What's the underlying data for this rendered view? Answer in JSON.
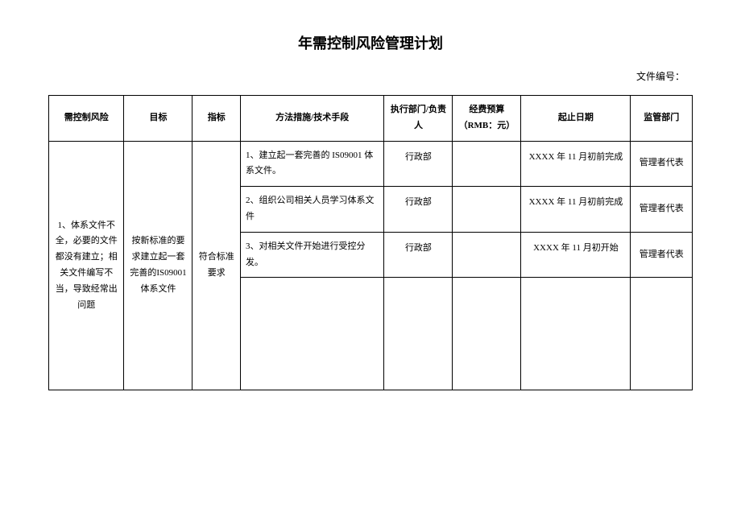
{
  "title": "年需控制风险管理计划",
  "doc_number_label": "文件编号：",
  "headers": {
    "risk": "需控制风险",
    "target": "目标",
    "index": "指标",
    "method": "方法措施/技术手段",
    "dept": "执行部门/负责人",
    "budget": "经费预算",
    "budget_unit": "（RMB：元）",
    "date": "起止日期",
    "supervisor": "监管部门"
  },
  "rows": {
    "risk": "1、体系文件不全，必要的文件都没有建立；相关文件编写不当，导致经常出问题",
    "target": "按新标准的要求建立起一套完善的IS09001 体系文件",
    "index": "符合标准要求",
    "methods": [
      {
        "method": "1、建立起一套完善的 IS09001 体系文件。",
        "dept": "行政部",
        "budget": "",
        "date": "XXXX 年 11 月初前完成",
        "supervisor": "管理者代表"
      },
      {
        "method": "2、组织公司相关人员学习体系文件",
        "dept": "行政部",
        "budget": "",
        "date": "XXXX 年 11 月初前完成",
        "supervisor": "管理者代表"
      },
      {
        "method": "3、对相关文件开始进行受控分发。",
        "dept": "行政部",
        "budget": "",
        "date": "XXXX 年 11 月初开始",
        "supervisor": "管理者代表"
      }
    ]
  }
}
